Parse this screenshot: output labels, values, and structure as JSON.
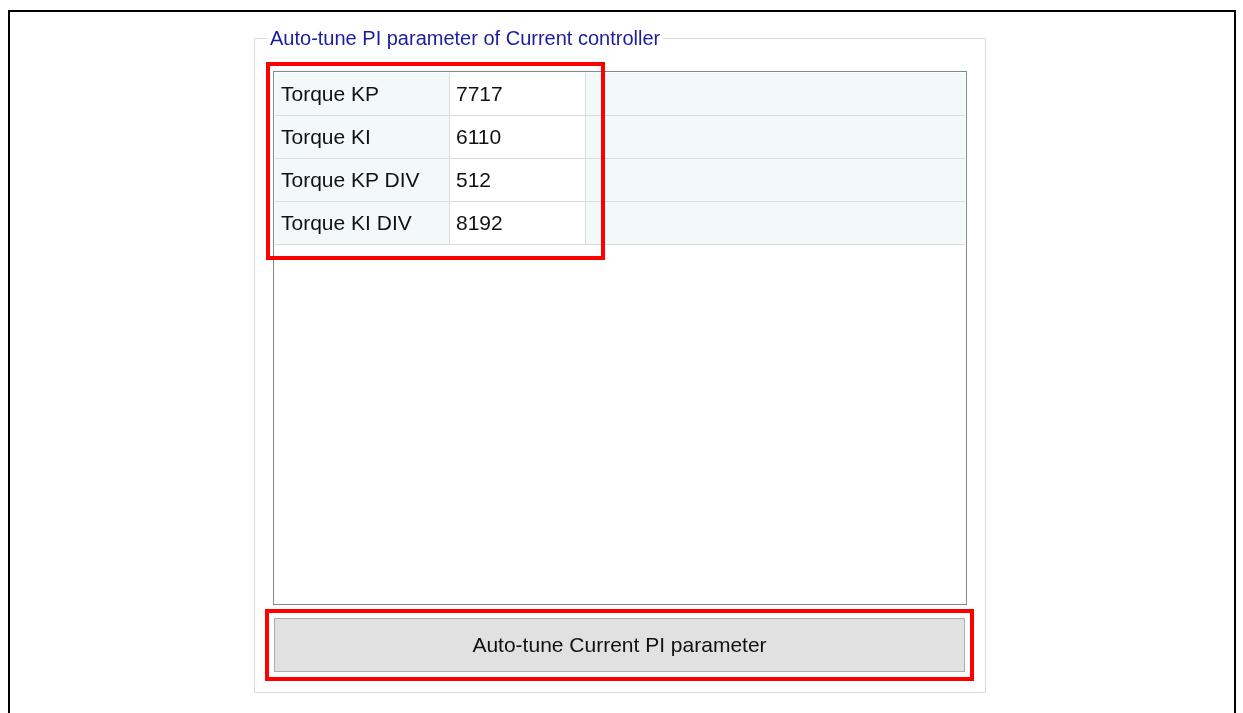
{
  "group": {
    "title": "Auto-tune PI parameter of Current controller"
  },
  "table": {
    "highlighted": true,
    "rows": [
      {
        "name": "Torque KP",
        "value": "7717"
      },
      {
        "name": "Torque KI",
        "value": "6110"
      },
      {
        "name": "Torque KP DIV",
        "value": "512"
      },
      {
        "name": "Torque KI DIV",
        "value": "8192"
      }
    ]
  },
  "button": {
    "label": "Auto-tune Current PI parameter",
    "highlighted": true
  }
}
